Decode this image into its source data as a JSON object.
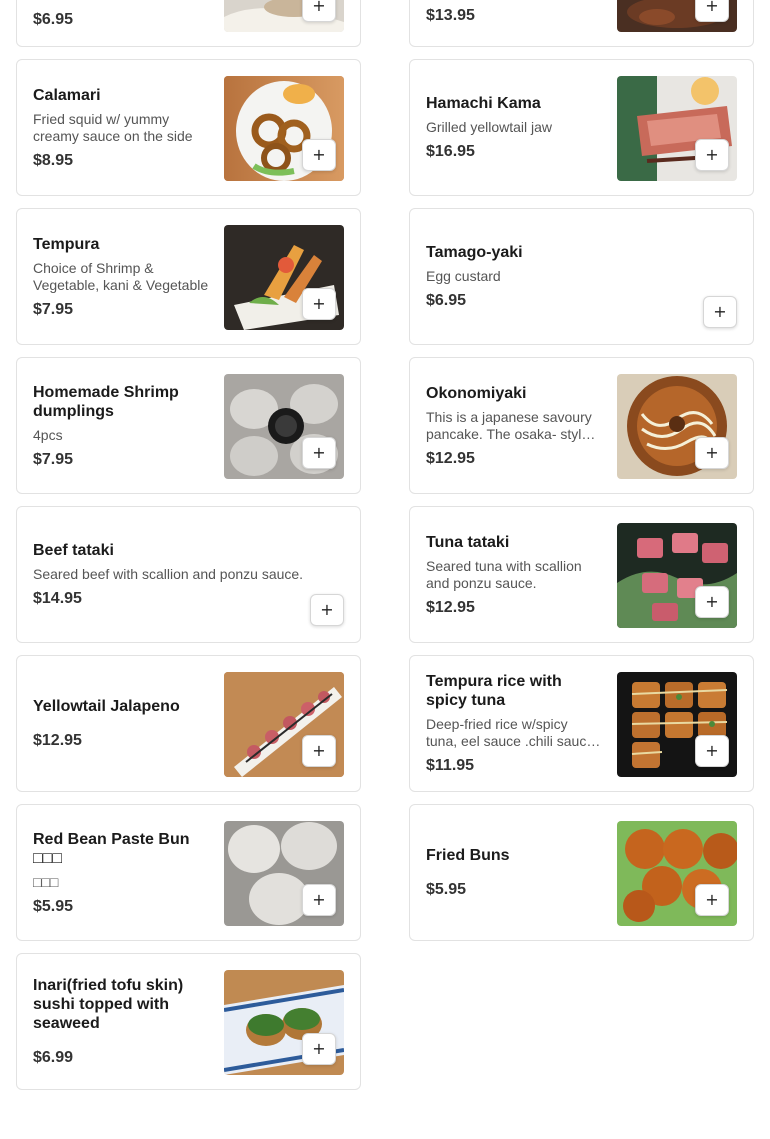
{
  "items": [
    {
      "name": "",
      "desc": "",
      "price": "$6.95"
    },
    {
      "name": "",
      "desc": "",
      "price": "$13.95"
    },
    {
      "name": "Calamari",
      "desc": "Fried squid w/ yummy creamy sauce on the side",
      "price": "$8.95"
    },
    {
      "name": "Hamachi Kama",
      "desc": "Grilled yellowtail jaw",
      "price": "$16.95"
    },
    {
      "name": "Tempura",
      "desc": "Choice of Shrimp & Vegetable, kani & Vegetable",
      "price": "$7.95"
    },
    {
      "name": "Tamago-yaki",
      "desc": "Egg custard",
      "price": "$6.95"
    },
    {
      "name": "Homemade Shrimp dumplings",
      "desc": "4pcs",
      "price": "$7.95"
    },
    {
      "name": "Okonomiyaki",
      "desc": "This is a japanese savoury pancake. The osaka- style okonomiyaki",
      "price": "$12.95"
    },
    {
      "name": "Beef tataki",
      "desc": "Seared beef with scallion and ponzu sauce.",
      "price": "$14.95"
    },
    {
      "name": "Tuna tataki",
      "desc": "Seared tuna with scallion and ponzu sauce.",
      "price": "$12.95"
    },
    {
      "name": "Yellowtail Jalapeno",
      "desc": "",
      "price": "$12.95"
    },
    {
      "name": "Tempura rice with spicy tuna",
      "desc": "Deep-fried rice w/spicy tuna, eel sauce .chili sauce and spicy mayo",
      "price": "$11.95"
    },
    {
      "name": "Red Bean Paste Bun □□□",
      "desc": "□□□",
      "price": "$5.95"
    },
    {
      "name": "Fried Buns",
      "desc": "",
      "price": "$5.95"
    },
    {
      "name": "Inari(fried tofu skin) sushi topped with seaweed",
      "desc": "",
      "price": "$6.99"
    }
  ],
  "icons": {
    "add": "plus-icon"
  },
  "colors": {
    "card_border": "#e2e2e2",
    "price": "#333333",
    "desc": "#555555"
  }
}
